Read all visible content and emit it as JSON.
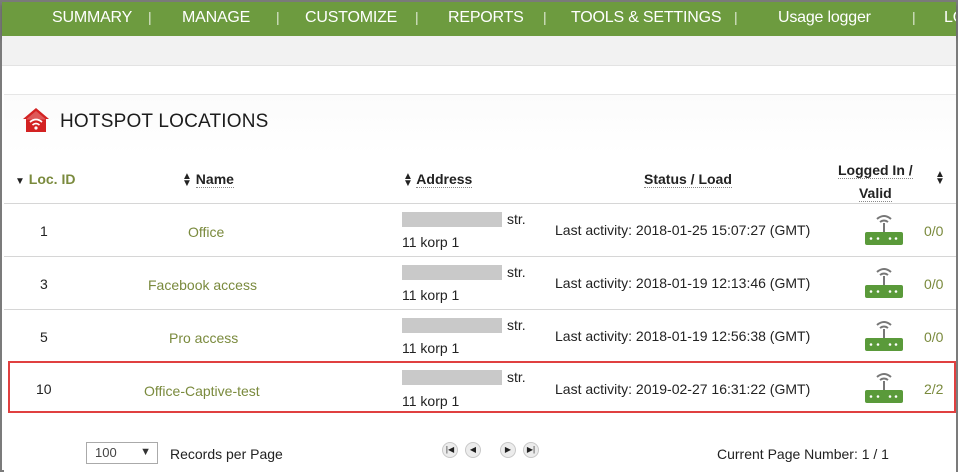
{
  "nav": {
    "items": [
      "SUMMARY",
      "MANAGE",
      "CUSTOMIZE",
      "REPORTS",
      "TOOLS & SETTINGS",
      "Usage logger",
      "LO"
    ],
    "separator": "|"
  },
  "section": {
    "title": "HOTSPOT LOCATIONS",
    "icon": "home-wifi-icon"
  },
  "table": {
    "headers": {
      "loc_id": "Loc. ID",
      "name": "Name",
      "address": "Address",
      "status": "Status / Load",
      "logged_line1": "Logged In /",
      "logged_line2": "Valid"
    },
    "rows": [
      {
        "id": "1",
        "name": "Office",
        "addr_suffix": "str.",
        "addr_line2": "11 korp 1",
        "status": "Last activity: 2018-01-25 15:07:27 (GMT)",
        "ratio": "0/0"
      },
      {
        "id": "3",
        "name": "Facebook access",
        "addr_suffix": "str.",
        "addr_line2": "11 korp 1",
        "status": "Last activity: 2018-01-19 12:13:46 (GMT)",
        "ratio": "0/0"
      },
      {
        "id": "5",
        "name": "Pro access",
        "addr_suffix": "str.",
        "addr_line2": "11 korp 1",
        "status": "Last activity: 2018-01-19 12:56:38 (GMT)",
        "ratio": "0/0"
      },
      {
        "id": "10",
        "name": "Office-Captive-test",
        "addr_suffix": "str.",
        "addr_line2": "11 korp 1",
        "status": "Last activity: 2019-02-27 16:31:22 (GMT)",
        "ratio": "2/2"
      }
    ]
  },
  "footer": {
    "per_page_value": "100",
    "per_page_label": "Records per Page",
    "page_label": "Current Page Number: 1 / 1"
  },
  "colors": {
    "nav_green": "#6d9b3f",
    "link_green": "#7a8a3d",
    "router_green": "#5a9a3a",
    "highlight": "#e04040"
  }
}
